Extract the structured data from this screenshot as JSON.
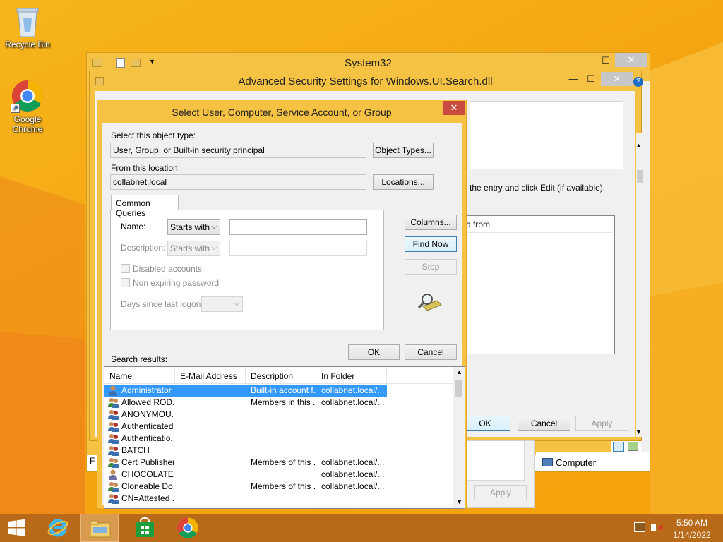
{
  "desktop": {
    "recycle_bin_label": "Recycle Bin",
    "chrome_label_line1": "Google",
    "chrome_label_line2": "Chrome"
  },
  "explorer_window": {
    "title": "System32",
    "right_text_fragment": "Computer"
  },
  "advanced_security_window": {
    "title": "Advanced Security Settings for Windows.UI.Search.dll",
    "instruction_fragment": "the entry and click Edit (if available).",
    "column_fragment": "d from",
    "ok_label": "OK",
    "cancel_label": "Cancel",
    "apply_label": "Apply"
  },
  "back_properties_window": {
    "apply_label": "Apply"
  },
  "select_dialog": {
    "title": "Select User, Computer, Service Account, or Group",
    "object_type_label": "Select this object type:",
    "object_type_value": "User, Group, or Built-in security principal",
    "object_types_button": "Object Types...",
    "location_label": "From this location:",
    "location_value": "collabnet.local",
    "locations_button": "Locations...",
    "tab_common_queries": "Common Queries",
    "name_label": "Name:",
    "name_mode": "Starts with",
    "description_label": "Description:",
    "description_mode": "Starts with",
    "disabled_accounts_label": "Disabled accounts",
    "non_expiring_label": "Non expiring password",
    "days_since_label": "Days since last logon:",
    "columns_button": "Columns...",
    "find_now_button": "Find Now",
    "stop_button": "Stop",
    "ok_button": "OK",
    "cancel_button": "Cancel",
    "search_results_label": "Search results:",
    "columns": [
      "Name",
      "E-Mail Address",
      "Description",
      "In Folder"
    ],
    "results": [
      {
        "name": "Administrator",
        "email": "",
        "description": "Built-in account f...",
        "folder": "collabnet.local/...",
        "icon": "user-icon",
        "selected": true
      },
      {
        "name": "Allowed ROD...",
        "email": "",
        "description": "Members in this ...",
        "folder": "collabnet.local/...",
        "icon": "group-icon",
        "selected": false
      },
      {
        "name": "ANONYMOU...",
        "email": "",
        "description": "",
        "folder": "",
        "icon": "special-group-icon",
        "selected": false
      },
      {
        "name": "Authenticated...",
        "email": "",
        "description": "",
        "folder": "",
        "icon": "special-group-icon",
        "selected": false
      },
      {
        "name": "Authenticatio...",
        "email": "",
        "description": "",
        "folder": "",
        "icon": "special-group-icon",
        "selected": false
      },
      {
        "name": "BATCH",
        "email": "",
        "description": "",
        "folder": "",
        "icon": "special-group-icon",
        "selected": false
      },
      {
        "name": "Cert Publishers",
        "email": "",
        "description": "Members of this ...",
        "folder": "collabnet.local/...",
        "icon": "group-icon",
        "selected": false
      },
      {
        "name": "CHOCOLATE...",
        "email": "",
        "description": "",
        "folder": "collabnet.local/...",
        "icon": "computer-icon",
        "selected": false
      },
      {
        "name": "Cloneable Do...",
        "email": "",
        "description": "Members of this ...",
        "folder": "collabnet.local/...",
        "icon": "group-icon",
        "selected": false
      },
      {
        "name": "CN=Attested ...",
        "email": "",
        "description": "",
        "folder": "",
        "icon": "special-group-icon",
        "selected": false
      }
    ]
  },
  "taskbar": {
    "time": "5:50 AM",
    "date": "1/14/2022"
  },
  "colors": {
    "wallpaper": "#f5a511",
    "window_frame": "#f6c243",
    "selection": "#3399ff",
    "taskbar": "#b86a18"
  }
}
